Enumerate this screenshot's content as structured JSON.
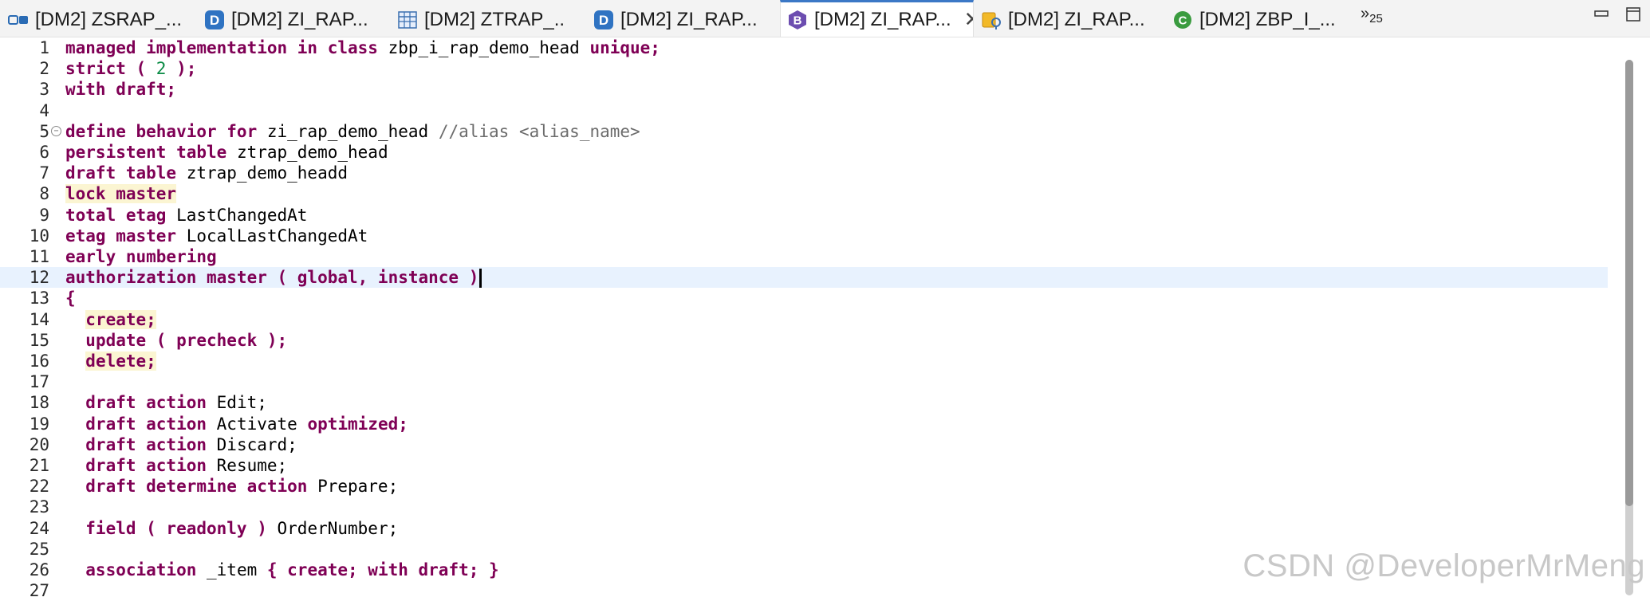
{
  "tabs": [
    {
      "label": "[DM2] ZSRAP_...",
      "icon": "service-binding-icon",
      "active": false
    },
    {
      "label": "[DM2] ZI_RAP...",
      "icon": "data-definition-icon",
      "active": false
    },
    {
      "label": "[DM2] ZTRAP_...",
      "icon": "table-icon",
      "active": false
    },
    {
      "label": "[DM2] ZI_RAP...",
      "icon": "data-definition-icon",
      "active": false
    },
    {
      "label": "[DM2] ZI_RAP...",
      "icon": "behavior-definition-icon",
      "active": true
    },
    {
      "label": "[DM2] ZI_RAP...",
      "icon": "access-control-icon",
      "active": false
    },
    {
      "label": "[DM2] ZBP_I_...",
      "icon": "abap-class-icon",
      "active": false
    }
  ],
  "overflow": {
    "chevrons": "»",
    "count": "25"
  },
  "editor": {
    "lines": [
      {
        "n": "1",
        "segs": [
          {
            "t": "managed implementation in class ",
            "c": "kw"
          },
          {
            "t": "zbp_i_rap_demo_head",
            "c": ""
          },
          {
            "t": " unique;",
            "c": "kw"
          }
        ]
      },
      {
        "n": "2",
        "segs": [
          {
            "t": "strict ( ",
            "c": "kw"
          },
          {
            "t": "2",
            "c": "num"
          },
          {
            "t": " );",
            "c": "kw"
          }
        ]
      },
      {
        "n": "3",
        "segs": [
          {
            "t": "with draft;",
            "c": "kw"
          }
        ]
      },
      {
        "n": "4",
        "segs": []
      },
      {
        "n": "5",
        "fold": true,
        "segs": [
          {
            "t": "define behavior for ",
            "c": "kw"
          },
          {
            "t": "zi_rap_demo_head ",
            "c": ""
          },
          {
            "t": "//alias <alias_name>",
            "c": "cmt"
          }
        ]
      },
      {
        "n": "6",
        "segs": [
          {
            "t": "persistent table ",
            "c": "kw"
          },
          {
            "t": "ztrap_demo_head",
            "c": ""
          }
        ]
      },
      {
        "n": "7",
        "segs": [
          {
            "t": "draft table ",
            "c": "kw"
          },
          {
            "t": "ztrap_demo_headd",
            "c": ""
          }
        ]
      },
      {
        "n": "8",
        "segs": [
          {
            "t": "lock master",
            "c": "kw hl"
          }
        ]
      },
      {
        "n": "9",
        "segs": [
          {
            "t": "total etag ",
            "c": "kw"
          },
          {
            "t": "LastChangedAt",
            "c": ""
          }
        ]
      },
      {
        "n": "10",
        "segs": [
          {
            "t": "etag master ",
            "c": "kw"
          },
          {
            "t": "LocalLastChangedAt",
            "c": ""
          }
        ]
      },
      {
        "n": "11",
        "segs": [
          {
            "t": "early numbering",
            "c": "kw"
          }
        ]
      },
      {
        "n": "12",
        "current": true,
        "segs": [
          {
            "t": "authorization master ( global, instance )",
            "c": "kw"
          }
        ],
        "caret": true
      },
      {
        "n": "13",
        "segs": [
          {
            "t": "{",
            "c": "kw"
          }
        ]
      },
      {
        "n": "14",
        "segs": [
          {
            "t": "  ",
            "c": ""
          },
          {
            "t": "create;",
            "c": "kw hl"
          }
        ]
      },
      {
        "n": "15",
        "segs": [
          {
            "t": "  ",
            "c": ""
          },
          {
            "t": "update ( precheck );",
            "c": "kw"
          }
        ]
      },
      {
        "n": "16",
        "segs": [
          {
            "t": "  ",
            "c": ""
          },
          {
            "t": "delete;",
            "c": "kw hl"
          }
        ]
      },
      {
        "n": "17",
        "segs": []
      },
      {
        "n": "18",
        "segs": [
          {
            "t": "  draft action ",
            "c": "kw"
          },
          {
            "t": "Edit;",
            "c": ""
          }
        ]
      },
      {
        "n": "19",
        "segs": [
          {
            "t": "  draft action ",
            "c": "kw"
          },
          {
            "t": "Activate ",
            "c": ""
          },
          {
            "t": "optimized;",
            "c": "kw"
          }
        ]
      },
      {
        "n": "20",
        "segs": [
          {
            "t": "  draft action ",
            "c": "kw"
          },
          {
            "t": "Discard;",
            "c": ""
          }
        ]
      },
      {
        "n": "21",
        "segs": [
          {
            "t": "  draft action ",
            "c": "kw"
          },
          {
            "t": "Resume;",
            "c": ""
          }
        ]
      },
      {
        "n": "22",
        "segs": [
          {
            "t": "  draft determine action ",
            "c": "kw"
          },
          {
            "t": "Prepare;",
            "c": ""
          }
        ]
      },
      {
        "n": "23",
        "segs": []
      },
      {
        "n": "24",
        "segs": [
          {
            "t": "  field ( readonly ) ",
            "c": "kw"
          },
          {
            "t": "OrderNumber;",
            "c": ""
          }
        ]
      },
      {
        "n": "25",
        "segs": []
      },
      {
        "n": "26",
        "segs": [
          {
            "t": "  association ",
            "c": "kw"
          },
          {
            "t": "_item ",
            "c": ""
          },
          {
            "t": "{ create; with draft; }",
            "c": "kw"
          }
        ]
      },
      {
        "n": "27",
        "segs": []
      }
    ]
  },
  "watermark": "CSDN @DeveloperMrMeng",
  "colors": {
    "keyword": "#7f0055",
    "number": "#0a8b45",
    "comment": "#6c6c6c",
    "current_line": "#e8f2fe",
    "highlight": "#fbf5d2",
    "active_tab_accent": "#3b78c6"
  }
}
